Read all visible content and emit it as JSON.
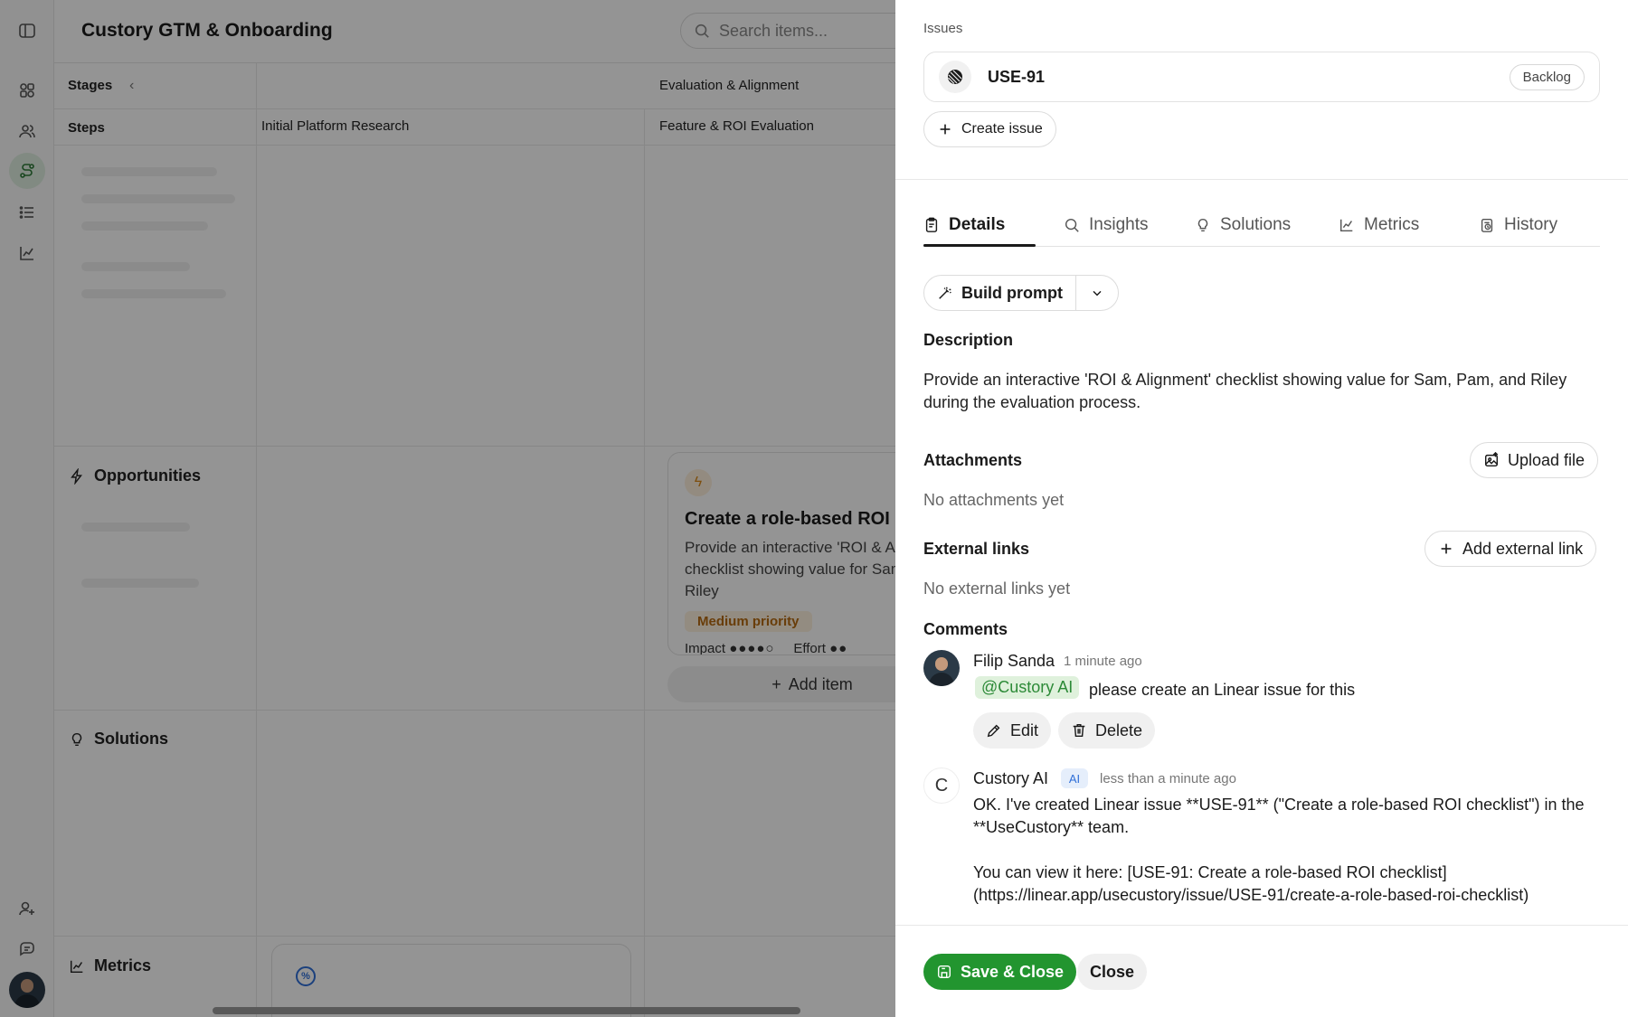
{
  "app": {
    "title": "Custory GTM & Onboarding",
    "search_placeholder": "Search items...",
    "headers": {
      "stages": "Stages",
      "steps": "Steps",
      "stage_evaluation": "Evaluation & Alignment",
      "step_research": "Initial Platform Research",
      "step_feature": "Feature & ROI Evaluation"
    },
    "rows": {
      "opportunities": "Opportunities",
      "solutions": "Solutions",
      "metrics": "Metrics"
    },
    "card": {
      "title": "Create a role-based ROI checklist",
      "description": "Provide an interactive 'ROI & Alignment' checklist showing value for Sam, Pam, and Riley",
      "priority": "Medium priority",
      "impact_label": "Impact",
      "impact_dots": "●●●●○",
      "effort_label": "Effort",
      "effort_dots": "●●"
    },
    "add_item": "Add item"
  },
  "panel": {
    "issues_label": "Issues",
    "issue": {
      "id": "USE-91",
      "status": "Backlog"
    },
    "create_issue": "Create issue",
    "tabs": [
      {
        "label": "Details",
        "icon": "clipboard-icon"
      },
      {
        "label": "Insights",
        "icon": "search-icon"
      },
      {
        "label": "Solutions",
        "icon": "lightbulb-icon"
      },
      {
        "label": "Metrics",
        "icon": "chart-line-icon"
      },
      {
        "label": "History",
        "icon": "history-icon"
      }
    ],
    "build_prompt": "Build prompt",
    "description_label": "Description",
    "description": "Provide an interactive 'ROI & Alignment' checklist showing value for Sam, Pam, and Riley during the evaluation process.",
    "attachments_label": "Attachments",
    "upload_file": "Upload file",
    "no_attachments": "No attachments yet",
    "external_links_label": "External links",
    "add_external_link": "Add external link",
    "no_external_links": "No external links yet",
    "comments_label": "Comments",
    "comments": [
      {
        "author": "Filip Sanda",
        "time": "1 minute ago",
        "mention": "@Custory AI",
        "text": "please create an Linear issue for this",
        "edit": "Edit",
        "delete": "Delete"
      },
      {
        "author": "Custory AI",
        "avatar_letter": "C",
        "badge": "AI",
        "time": "less than a minute ago",
        "line1": "OK. I've created Linear issue **USE-91** (\"Create a role-based ROI checklist\") in the",
        "line2": "**UseCustory** team.",
        "line3": "You can view it here: [USE-91: Create a role-based ROI checklist]",
        "line4": "(https://linear.app/usecustory/issue/USE-91/create-a-role-based-roi-checklist)"
      }
    ],
    "save_close": "Save & Close",
    "close": "Close"
  },
  "colors": {
    "accent_green": "#22952f",
    "mention_green": "#2c8a37",
    "priority_orange": "#b56a10",
    "ai_blue": "#2f6fd8"
  }
}
